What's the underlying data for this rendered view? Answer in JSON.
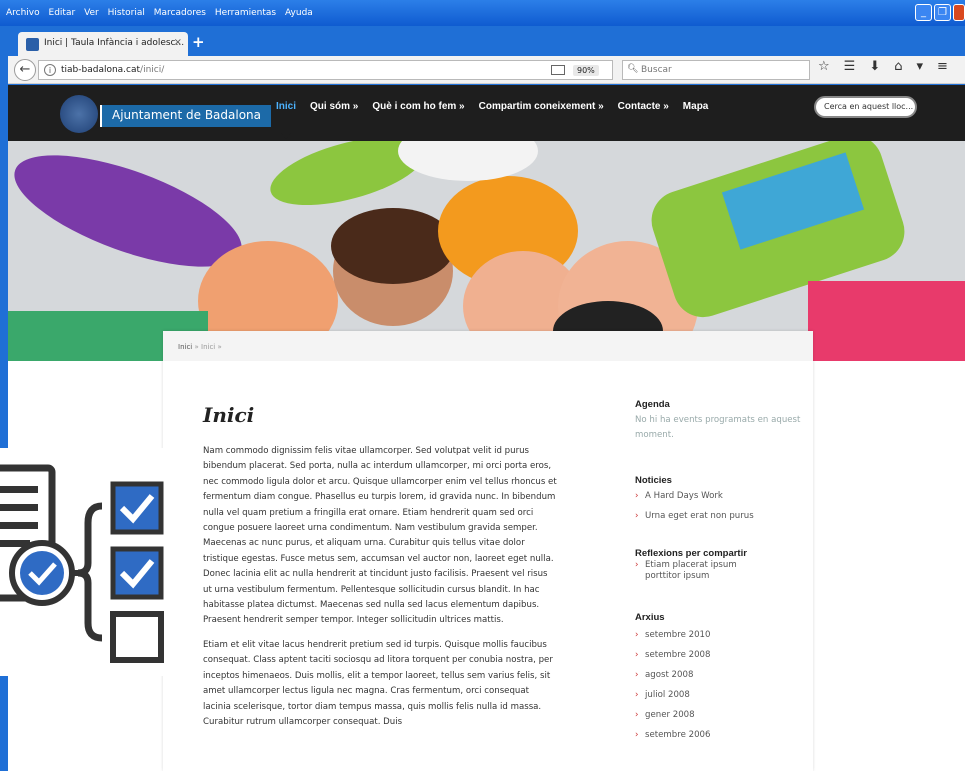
{
  "browser": {
    "menu": [
      "Archivo",
      "Editar",
      "Ver",
      "Historial",
      "Marcadores",
      "Herramientas",
      "Ayuda"
    ],
    "tab_title": "Inici | Taula Infància i adolesc...",
    "tab_close": "×",
    "new_tab": "+",
    "url_host": "tiab-badalona.cat",
    "url_path": "/inici/",
    "zoom": "90%",
    "search_placeholder": "Buscar"
  },
  "site": {
    "name": "Ajuntament de Badalona",
    "nav": [
      "Inici",
      "Qui sóm »",
      "Què i com ho fem »",
      "Compartim coneixement »",
      "Contacte »",
      "Mapa"
    ],
    "search_placeholder": "Cerca en aquest lloc..."
  },
  "breadcrumb": {
    "home": "Inici",
    "sep": "»",
    "current": "Inici",
    "sep2": "»"
  },
  "main": {
    "title": "Inici",
    "paragraphs": [
      "Nam commodo dignissim felis vitae ullamcorper. Sed volutpat velit id purus bibendum placerat. Sed porta, nulla ac interdum ullamcorper, mi orci porta eros, nec commodo ligula dolor et arcu. Quisque ullamcorper enim vel tellus rhoncus et fermentum diam congue. Phasellus eu turpis lorem, id gravida nunc. In bibendum nulla vel quam pretium a fringilla erat ornare. Etiam hendrerit quam sed orci congue posuere laoreet urna condimentum. Nam vestibulum gravida semper. Maecenas ac nunc purus, et aliquam urna. Curabitur quis tellus vitae dolor tristique egestas. Fusce metus sem, accumsan vel auctor non, laoreet eget nulla. Donec lacinia elit ac nulla hendrerit at tincidunt justo facilisis. Praesent vel risus ut urna vestibulum fermentum. Pellentesque sollicitudin cursus blandit. In hac habitasse platea dictumst. Maecenas sed nulla sed lacus elementum dapibus. Praesent hendrerit semper tempor. Integer sollicitudin ultrices mattis.",
      "Etiam et elit vitae lacus hendrerit pretium sed id turpis. Quisque mollis faucibus consequat. Class aptent taciti sociosqu ad litora torquent per conubia nostra, per inceptos himenaeos. Duis mollis, elit a tempor laoreet, tellus sem varius felis, sit amet ullamcorper lectus ligula nec magna. Cras fermentum, orci consequat lacinia scelerisque, tortor diam tempus massa, quis mollis felis nulla id massa. Curabitur rutrum ullamcorper consequat. Duis"
    ]
  },
  "sidebar": {
    "agenda_title": "Agenda",
    "agenda_text": "No hi ha events programats en aquest moment.",
    "noticies_title": "Noticies",
    "noticies": [
      "A Hard Days Work",
      "Urna eget erat non purus"
    ],
    "reflexions_title": "Reflexions per compartir",
    "reflexions": [
      "Etiam placerat ipsum porttitor ipsum"
    ],
    "arxius_title": "Arxius",
    "arxius": [
      "setembre 2010",
      "setembre 2008",
      "agost 2008",
      "juliol 2008",
      "gener 2008",
      "setembre 2006"
    ]
  },
  "colors": {
    "accent": "#1c6aa8",
    "nav_active": "#4db3ff",
    "check_blue": "#2f6bc4",
    "dark": "#222222"
  }
}
